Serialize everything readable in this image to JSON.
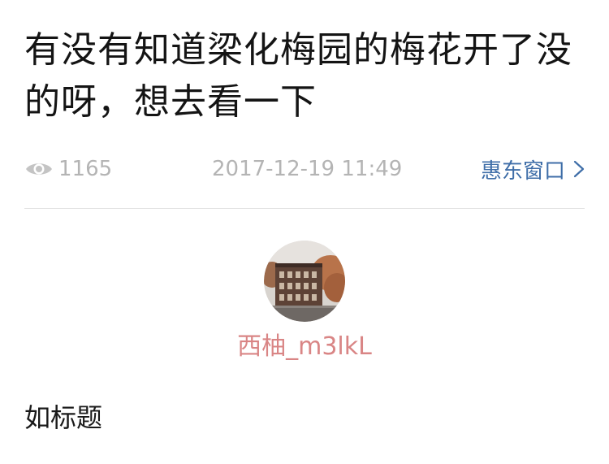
{
  "post": {
    "title": "有没有知道梁化梅园的梅花开了没的呀，想去看一下",
    "views": "1165",
    "timestamp": "2017-12-19 11:49",
    "channel": "惠东窗口",
    "body": "如标题"
  },
  "author": {
    "name": "西柚_m3lkL",
    "avatar_icon": "building-photo-avatar"
  },
  "colors": {
    "meta_gray": "#b4b4b4",
    "link_blue": "#3f6ea8",
    "username_pink": "#d98585",
    "divider": "#e2e2e2"
  },
  "icons": {
    "views": "eye-icon",
    "channel_arrow": "chevron-right-icon"
  }
}
